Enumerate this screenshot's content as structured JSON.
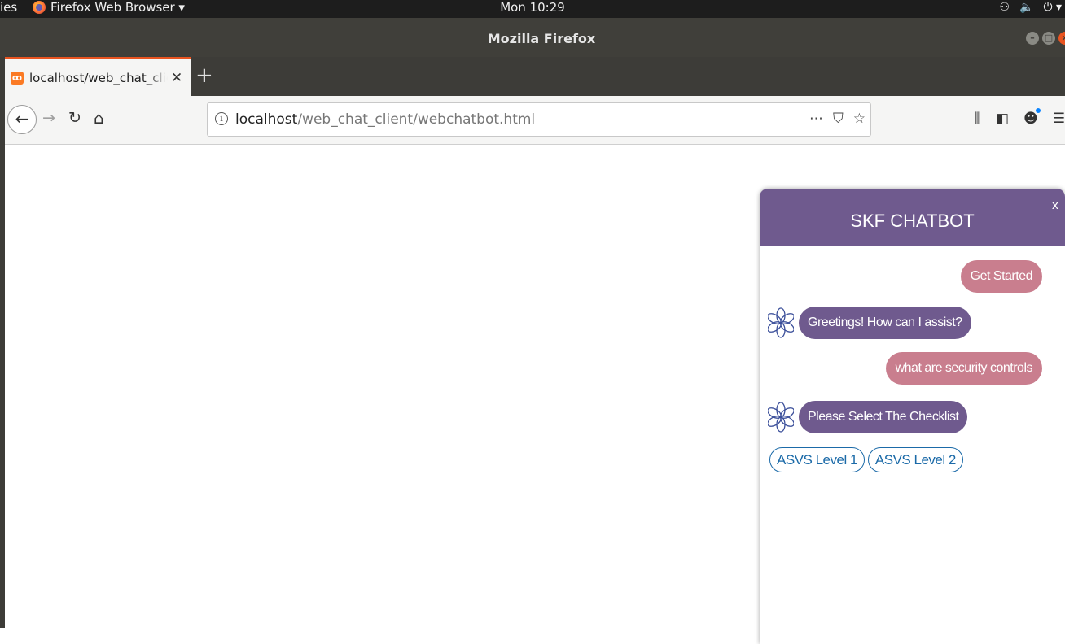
{
  "system_bar": {
    "activities": "ies",
    "app_menu": "Firefox Web Browser ▾",
    "clock": "Mon 10:29",
    "tray": [
      "network-icon",
      "volume-icon",
      "power-icon"
    ]
  },
  "window": {
    "title": "Mozilla Firefox"
  },
  "tabs": [
    {
      "label": "localhost/web_chat_client/webchatbot.html",
      "close": "✕"
    }
  ],
  "new_tab": "+",
  "url": {
    "host": "localhost",
    "path": "/web_chat_client/webchatbot.html",
    "page_actions": [
      "⋯",
      "⛉",
      "☆"
    ]
  },
  "toolbar_icons": [
    "library-icon",
    "sidebar-icon",
    "account-icon",
    "menu-icon"
  ],
  "chatbot": {
    "title": "SKF CHATBOT",
    "close_label": "x",
    "messages": [
      {
        "from": "user",
        "text": "Get Started"
      },
      {
        "from": "bot",
        "text": "Greetings! How can I assist?"
      },
      {
        "from": "user",
        "text": "what are security controls"
      },
      {
        "from": "bot",
        "text": "Please Select The Checklist"
      }
    ],
    "quick_replies": [
      "ASVS Level 1",
      "ASVS Level 2"
    ]
  },
  "colors": {
    "header": "#6f5a8e",
    "user_bubble": "#c97e8e",
    "bot_bubble": "#6f5a8e",
    "quick_reply": "#1b6aa8",
    "tab_accent": "#e95420"
  }
}
